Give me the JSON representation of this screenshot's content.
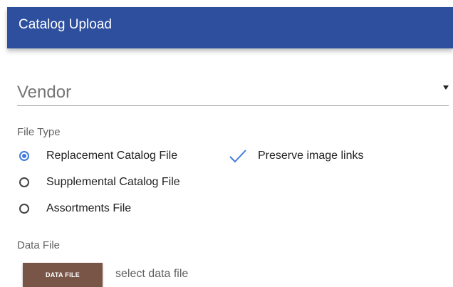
{
  "header": {
    "title": "Catalog Upload",
    "background_color": "#2d4f9e"
  },
  "vendor": {
    "placeholder": "Vendor",
    "icon": "dropdown-arrow-icon"
  },
  "file_type": {
    "label": "File Type",
    "options": [
      {
        "label": "Replacement Catalog File",
        "selected": true
      },
      {
        "label": "Supplemental Catalog File",
        "selected": false
      },
      {
        "label": "Assortments File",
        "selected": false
      }
    ],
    "accent_color": "#3f7bdc"
  },
  "preserve_links": {
    "label": "Preserve image links",
    "checked": true,
    "icon": "checkmark-icon"
  },
  "data_file": {
    "label": "Data File",
    "button_label": "DATA FILE",
    "placeholder": "select data file",
    "button_color": "#795548"
  }
}
